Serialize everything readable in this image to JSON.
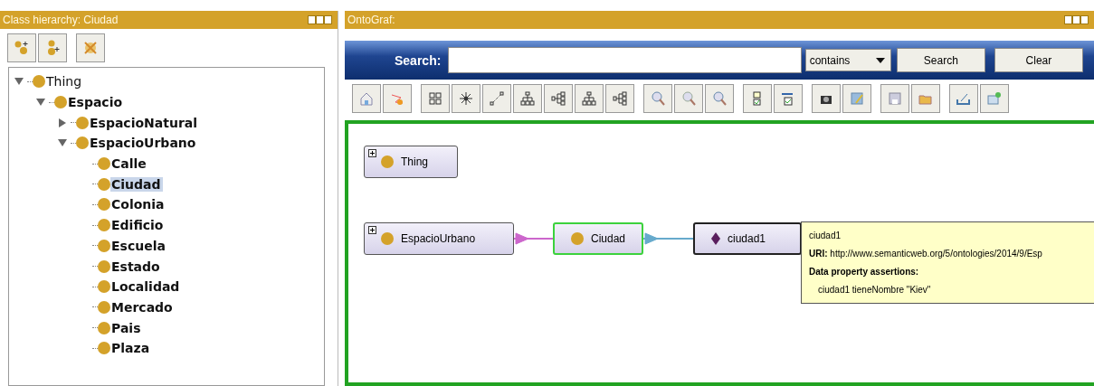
{
  "class_hierarchy": {
    "title": "Class hierarchy: Ciudad",
    "tree": [
      {
        "label": "Thing",
        "expanded": true,
        "selected": false,
        "children": [
          {
            "label": "Espacio",
            "expanded": true,
            "selected": false,
            "children": [
              {
                "label": "EspacioNatural",
                "expanded": false,
                "selected": false
              },
              {
                "label": "EspacioUrbano",
                "expanded": true,
                "selected": false,
                "children": [
                  {
                    "label": "Calle",
                    "selected": false
                  },
                  {
                    "label": "Ciudad",
                    "selected": true
                  },
                  {
                    "label": "Colonia",
                    "selected": false
                  },
                  {
                    "label": "Edificio",
                    "selected": false
                  },
                  {
                    "label": "Escuela",
                    "selected": false
                  },
                  {
                    "label": "Estado",
                    "selected": false
                  },
                  {
                    "label": "Localidad",
                    "selected": false
                  },
                  {
                    "label": "Mercado",
                    "selected": false
                  },
                  {
                    "label": "Pais",
                    "selected": false
                  },
                  {
                    "label": "Plaza",
                    "selected": false
                  }
                ]
              }
            ]
          }
        ]
      }
    ]
  },
  "ontograf": {
    "title": "OntoGraf:",
    "search": {
      "label": "Search:",
      "match": "contains",
      "buttons": [
        "Search",
        "Clear"
      ]
    },
    "nodes": [
      {
        "label": "Thing",
        "kind": "class",
        "expandable": true,
        "selected": false
      },
      {
        "label": "EspacioUrbano",
        "kind": "class",
        "expandable": true,
        "selected": false
      },
      {
        "label": "Ciudad",
        "kind": "class",
        "expandable": false,
        "selected": true
      },
      {
        "label": "ciudad1",
        "kind": "individual",
        "expandable": false,
        "selected": false
      }
    ],
    "edges": [
      {
        "color": "#cc66cc"
      },
      {
        "color": "#66aacc"
      }
    ],
    "tooltip": {
      "title": "ciudad1",
      "uri_label": "URI:",
      "uri": "http://www.semanticweb.org/5/ontologies/2014/9/Esp",
      "section": "Data property assertions:",
      "assertions": [
        "ciudad1 tieneNombre \"Kiev\""
      ]
    }
  }
}
